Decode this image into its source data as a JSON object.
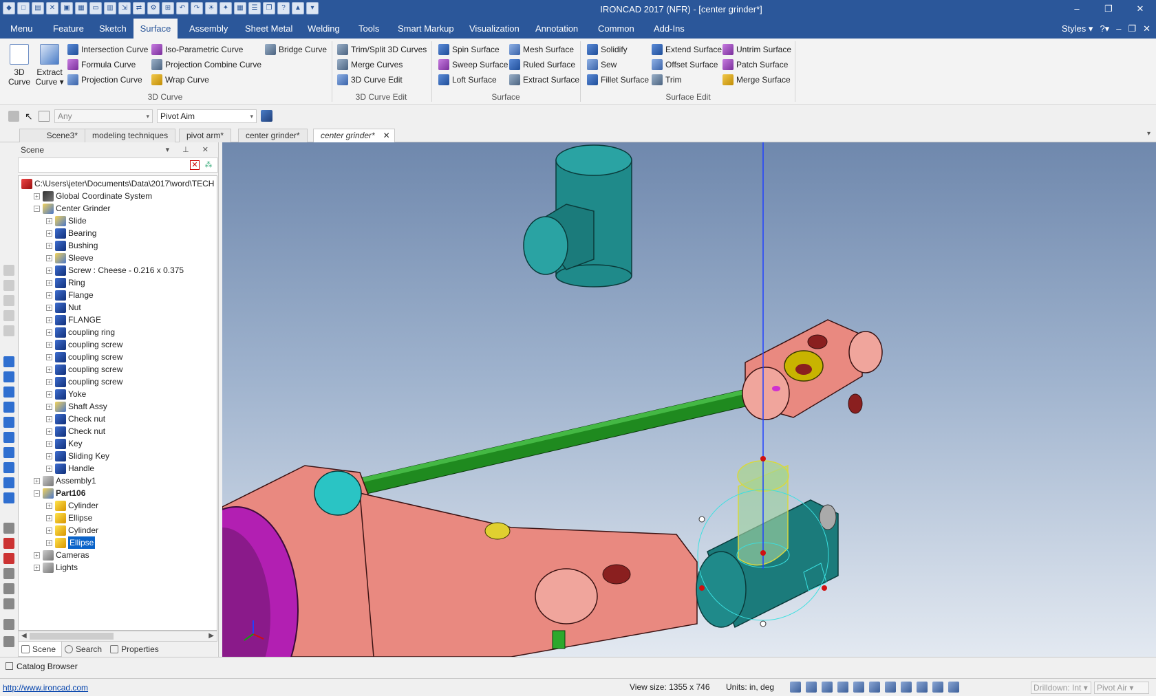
{
  "window": {
    "title": "IRONCAD 2017 (NFR) - [center grinder*]",
    "controls": {
      "minimize": "–",
      "restore": "❐",
      "close": "✕"
    }
  },
  "menu": {
    "tabs": [
      "Menu",
      "Feature",
      "Sketch",
      "Surface",
      "Assembly",
      "Sheet Metal",
      "Welding",
      "Tools",
      "Smart Markup",
      "Visualization",
      "Annotation",
      "Common",
      "Add-Ins"
    ],
    "active": "Surface",
    "styles": "Styles"
  },
  "ribbon": {
    "curve3d": {
      "big1_line1": "3D",
      "big1_line2": "Curve",
      "big2_line1": "Extract",
      "big2_line2": "Curve ▾",
      "intersection": "Intersection Curve",
      "formula": "Formula Curve",
      "projection": "Projection Curve",
      "iso": "Iso-Parametric Curve",
      "projcombine": "Projection Combine Curve",
      "wrap": "Wrap Curve",
      "bridge": "Bridge Curve",
      "label": "3D Curve"
    },
    "curveedit": {
      "trim": "Trim/Split 3D Curves",
      "merge": "Merge Curves",
      "edit": "3D Curve Edit",
      "label": "3D Curve Edit"
    },
    "surface": {
      "spin": "Spin Surface",
      "sweep": "Sweep Surface",
      "loft": "Loft Surface",
      "mesh": "Mesh Surface",
      "ruled": "Ruled Surface",
      "extract": "Extract Surface",
      "label": "Surface"
    },
    "surfaceedit": {
      "solidify": "Solidify",
      "sew": "Sew",
      "fillet": "Fillet Surface",
      "extend": "Extend Surface",
      "offset": "Offset Surface",
      "trim": "Trim",
      "untrim": "Untrim Surface",
      "patch": "Patch Surface",
      "mergesurf": "Merge Surface",
      "label": "Surface Edit"
    }
  },
  "selection": {
    "filter": "Any",
    "mode": "Pivot Aim"
  },
  "doc_tabs": [
    "Scene3*",
    "modeling techniques",
    "pivot arm*",
    "center grinder*",
    "center grinder*"
  ],
  "scene": {
    "title": "Scene",
    "root": "C:\\Users\\jeter\\Documents\\Data\\2017\\word\\TECH",
    "nodes": [
      "Global Coordinate System",
      "Center Grinder",
      "Slide",
      "Bearing",
      "Bushing",
      "Sleeve",
      "Screw : Cheese - 0.216 x 0.375",
      "Ring",
      "Flange",
      "Nut",
      "FLANGE",
      "coupling ring",
      "coupling screw",
      "coupling screw",
      "coupling screw",
      "coupling screw",
      "Yoke",
      "Shaft Assy",
      "Check nut",
      "Check nut",
      "Key",
      "Sliding Key",
      "Handle",
      "Assembly1",
      "Part106",
      "Cylinder",
      "Ellipse",
      "Cylinder",
      "Ellipse",
      "Cameras",
      "Lights"
    ],
    "tabs": [
      "Scene",
      "Search",
      "Properties"
    ]
  },
  "catalog": "Catalog Browser",
  "status": {
    "url": "http://www.ironcad.com",
    "view_size": "View size: 1355 x  746",
    "units": "Units: in, deg",
    "drilldown": "Drilldown: Int",
    "pivot": "Pivot Air"
  }
}
